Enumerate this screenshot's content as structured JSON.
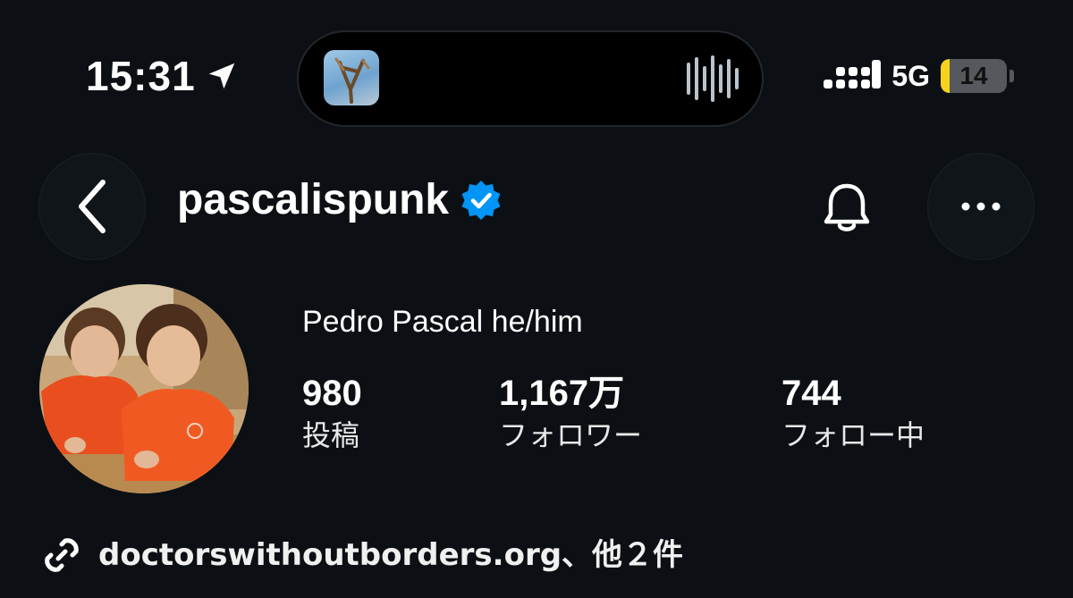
{
  "status_bar": {
    "time": "15:31",
    "network": "5G",
    "battery_level": 14,
    "battery_label": "14",
    "icons": [
      "location-arrow-icon",
      "cellular-signal-icon",
      "battery-icon"
    ]
  },
  "dynamic_island": {
    "icons": [
      "now-playing-artwork",
      "audio-waveform-icon"
    ]
  },
  "header": {
    "username": "pascalispunk",
    "verified": true,
    "icons": [
      "back-chevron-icon",
      "verified-badge-icon",
      "bell-icon",
      "more-dots-icon"
    ]
  },
  "profile": {
    "display_name": "Pedro Pascal he/him",
    "stats": {
      "posts_count": "980",
      "posts_label": "投稿",
      "followers_count": "1,167万",
      "followers_label": "フォロワー",
      "following_count": "744",
      "following_label": "フォロー中"
    }
  },
  "link": {
    "text": "doctorswithoutborders.org、他２件",
    "icon": "link-icon"
  },
  "colors": {
    "background": "#0c1014",
    "verified_badge": "#0095f6",
    "battery_fill": "#f7d21d",
    "text_primary": "#ffffff"
  }
}
